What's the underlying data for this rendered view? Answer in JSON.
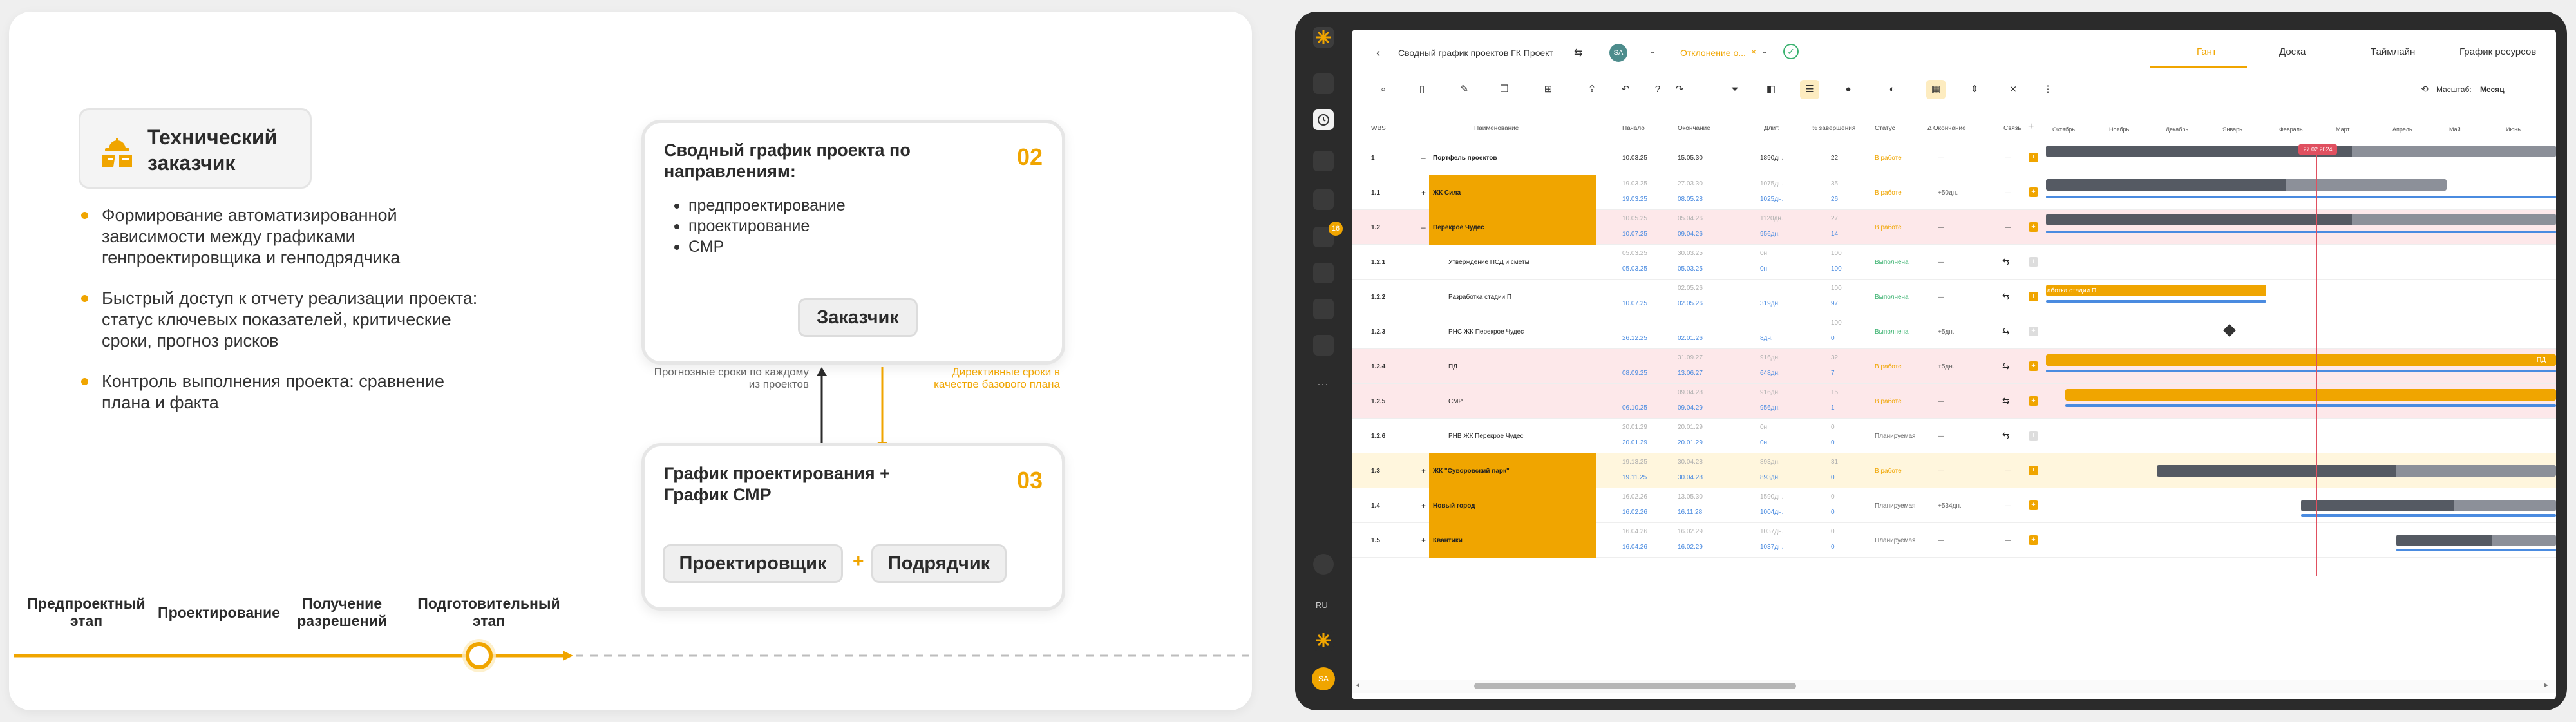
{
  "slide": {
    "role_title": "Технический заказчик",
    "bullets": [
      "Формирование автоматизированной зависимости между графиками генпроектировщика и генподрядчика",
      "Быстрый доступ к отчету реализации проекта: статус ключевых показателей, критические сроки, прогноз рисков",
      "Контроль выполнения проекта: сравнение плана и факта"
    ],
    "card02": {
      "title": "Сводный график проекта по направлениям:",
      "num": "02",
      "items": [
        "предпроектирование",
        "проектирование",
        "СМР"
      ],
      "pill": "Заказчик"
    },
    "card03": {
      "title": "График проектирования + График СМР",
      "num": "03",
      "pill1": "Проектировщик",
      "plus": "+",
      "pill2": "Подрядчик"
    },
    "note_left": "Прогнозные сроки по каждому из проектов",
    "note_right": "Директивные сроки в качестве базового плана",
    "stages": [
      "Предпроектный этап",
      "Проектирование",
      "Получение разрешений",
      "Подготовительный этап"
    ],
    "accent": "#f0a500"
  },
  "app": {
    "title": "Сводный график проектов ГК Проект",
    "user": "SA",
    "filter": "Отклонение о...",
    "tabs": [
      "Гант",
      "Доска",
      "Таймлайн",
      "График ресурсов"
    ],
    "active_tab": "Гант",
    "scale_label": "Масштаб:",
    "scale_value": "Месяц",
    "lang": "RU",
    "badge": "16",
    "columns": [
      "WBS",
      "Наименование",
      "Начало",
      "Окончание",
      "Длит.",
      "% завершения",
      "Статус",
      "Δ Окончание",
      "Связь"
    ],
    "months": [
      "Октябрь",
      "Ноябрь",
      "Декабрь",
      "Январь",
      "Февраль",
      "Март",
      "Апрель",
      "Май",
      "Июнь"
    ],
    "today": "27.02.2024",
    "rows": [
      {
        "wbs": "1",
        "name": "Портфель проектов",
        "s1": "10.03.25",
        "e1": "15.05.30",
        "d1": "1890дн.",
        "p1": "22",
        "status": "В работе",
        "delta": "—",
        "link": "—"
      },
      {
        "wbs": "1.1",
        "name": "ЖК Сила",
        "s0": "19.03.25",
        "e0": "27.03.30",
        "d0": "1075дн.",
        "p0": "35",
        "s1": "19.03.25",
        "e1": "08.05.28",
        "d1": "1025дн.",
        "p1": "26",
        "status": "В работе",
        "delta": "+50дн.",
        "link": "—"
      },
      {
        "wbs": "1.2",
        "name": "Перекрое Чудес",
        "s0": "10.05.25",
        "e0": "05.04.26",
        "d0": "1120дн.",
        "p0": "27",
        "s1": "10.07.25",
        "e1": "09.04.26",
        "d1": "956дн.",
        "p1": "14",
        "status": "В работе",
        "delta": "—",
        "link": "—"
      },
      {
        "wbs": "1.2.1",
        "name": "Утверждение ПСД и сметы",
        "s0": "05.03.25",
        "e0": "30.03.25",
        "d0": "0н.",
        "p0": "100",
        "s1": "05.03.25",
        "e1": "05.03.25",
        "d1": "0н.",
        "p1": "100",
        "status": "Выполнена",
        "delta": "—",
        "link": ""
      },
      {
        "wbs": "1.2.2",
        "name": "Разработка стадии П",
        "s0": "",
        "e0": "02.05.26",
        "d0": "",
        "p0": "100",
        "s1": "10.07.25",
        "e1": "02.05.26",
        "d1": "319дн.",
        "p1": "97",
        "status": "Выполнена",
        "delta": "—",
        "link": ""
      },
      {
        "wbs": "1.2.3",
        "name": "РНС ЖК Перекрое Чудес",
        "s0": "",
        "e0": "",
        "d0": "",
        "p0": "100",
        "s1": "26.12.25",
        "e1": "02.01.26",
        "d1": "8дн.",
        "p1": "0",
        "status": "Выполнена",
        "delta": "+5дн.",
        "link": ""
      },
      {
        "wbs": "1.2.4",
        "name": "ПД",
        "s0": "",
        "e0": "31.09.27",
        "d0": "916дн.",
        "p0": "32",
        "s1": "08.09.25",
        "e1": "13.06.27",
        "d1": "648дн.",
        "p1": "7",
        "status": "В работе",
        "delta": "+5дн.",
        "link": ""
      },
      {
        "wbs": "1.2.5",
        "name": "СМР",
        "s0": "",
        "e0": "09.04.28",
        "d0": "916дн.",
        "p0": "15",
        "s1": "06.10.25",
        "e1": "09.04.29",
        "d1": "956дн.",
        "p1": "1",
        "status": "В работе",
        "delta": "—",
        "link": ""
      },
      {
        "wbs": "1.2.6",
        "name": "РНВ ЖК Перекрое Чудес",
        "s0": "20.01.29",
        "e0": "20.01.29",
        "d0": "0н.",
        "p0": "0",
        "s1": "20.01.29",
        "e1": "20.01.29",
        "d1": "0н.",
        "p1": "0",
        "status": "Планируемая",
        "delta": "—",
        "link": ""
      },
      {
        "wbs": "1.3",
        "name": "ЖК \"Суворовский парк\"",
        "s0": "19.13.25",
        "e0": "30.04.28",
        "d0": "893дн.",
        "p0": "31",
        "s1": "19.11.25",
        "e1": "30.04.28",
        "d1": "893дн.",
        "p1": "0",
        "status": "В работе",
        "delta": "—",
        "link": "—"
      },
      {
        "wbs": "1.4",
        "name": "Новый город",
        "s0": "16.02.26",
        "e0": "13.05.30",
        "d0": "1590дн.",
        "p0": "0",
        "s1": "16.02.26",
        "e1": "16.11.28",
        "d1": "1004дн.",
        "p1": "0",
        "status": "Планируемая",
        "delta": "+534дн.",
        "link": "—"
      },
      {
        "wbs": "1.5",
        "name": "Квантики",
        "s0": "16.04.26",
        "e0": "16.02.29",
        "d0": "1037дн.",
        "p0": "0",
        "s1": "16.04.26",
        "e1": "16.02.29",
        "d1": "1037дн.",
        "p1": "0",
        "status": "Планируемая",
        "delta": "—",
        "link": "—"
      }
    ],
    "bar_label_1": "аботка стадии П",
    "bar_label_2": "ПД",
    "colors": {
      "orange": "#f0a500",
      "dark": "#555a63",
      "blue": "#4a8be0",
      "red": "#e05060",
      "pink": "#fde8ea",
      "yellow": "#fff6dd"
    }
  }
}
